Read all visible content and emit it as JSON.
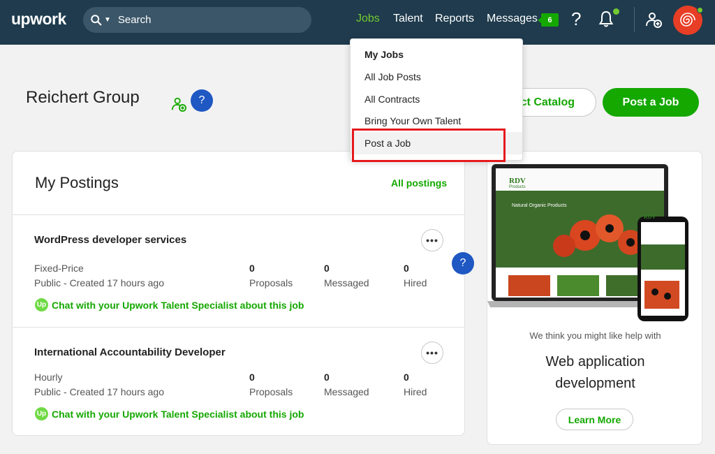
{
  "header": {
    "logo": "upwork",
    "search_placeholder": "Search",
    "nav": {
      "jobs": "Jobs",
      "talent": "Talent",
      "reports": "Reports",
      "messages": "Messages",
      "messages_count": "6"
    },
    "help": "?",
    "accent_color": "#73ca30",
    "bar_color": "#1f3b4d"
  },
  "jobs_menu": {
    "items": [
      "My Jobs",
      "All Job Posts",
      "All Contracts",
      "Bring Your Own Talent",
      "Post a Job"
    ]
  },
  "page": {
    "company_name": "Reichert Group",
    "help": "?",
    "catalog_button": "ct Catalog",
    "post_job_button": "Post a Job"
  },
  "postings": {
    "title": "My Postings",
    "all_link": "All postings",
    "items": [
      {
        "title": "WordPress developer services",
        "type": "Fixed-Price",
        "visibility": "Public - Created 17 hours ago",
        "proposals": "0",
        "proposals_label": "Proposals",
        "messaged": "0",
        "messaged_label": "Messaged",
        "hired": "0",
        "hired_label": "Hired",
        "chat": "Chat with your Upwork Talent Specialist about this job"
      },
      {
        "title": "International Accountability Developer",
        "type": "Hourly",
        "visibility": "Public - Created 17 hours ago",
        "proposals": "0",
        "proposals_label": "Proposals",
        "messaged": "0",
        "messaged_label": "Messaged",
        "hired": "0",
        "hired_label": "Hired",
        "chat": "Chat with your Upwork Talent Specialist about this job"
      }
    ],
    "float_help": "?"
  },
  "promo": {
    "intro": "We think you might like help with",
    "heading_line1": "Web application",
    "heading_line2": "development",
    "button": "Learn More",
    "mockup_brand": "RDV",
    "mockup_brand_sub": "Products",
    "mockup_banner": "Natural Organic Products"
  }
}
